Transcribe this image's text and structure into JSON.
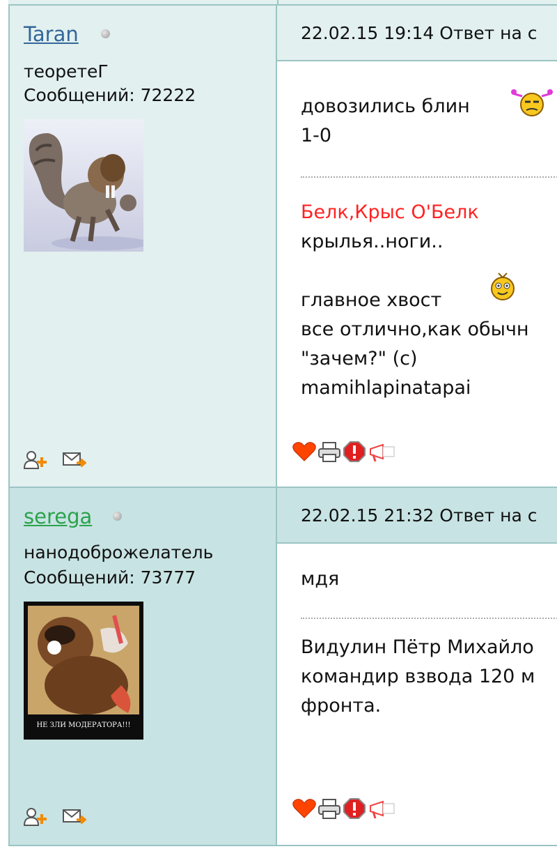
{
  "posts": [
    {
      "username": "Taran",
      "rank": "теоретеГ",
      "posts_count": "Сообщений: 72222",
      "avatar": "squirrel-avatar",
      "header": "22.02.15 19:14  Ответ на с",
      "body_lines": [
        "довозились блин",
        "1-0"
      ],
      "signature_red": "Белк,Крыс О'Белк",
      "signature_lines": [
        "крылья..ноги..",
        "",
        "главное хвост",
        "все отлично,как обычн",
        "\"зачем?\" (с)",
        "mamihlapinatapai"
      ],
      "user_colors": {
        "name": "#336699"
      }
    },
    {
      "username": "serega",
      "rank": "нанодоброжелатель",
      "posts_count": "Сообщений: 73777",
      "avatar": "bear-moderator-avatar",
      "avatar_caption": "НЕ ЗЛИ МОДЕРАТОРА!!!",
      "header": "22.02.15 21:32  Ответ на с",
      "body_lines": [
        "мдя"
      ],
      "signature_lines": [
        "Видулин Пётр Михайло",
        "командир взвода 120 м",
        "фронта."
      ],
      "user_colors": {
        "name": "#2ba24c"
      }
    }
  ],
  "icons": {
    "user_actions": [
      "add-friend-icon",
      "send-message-icon"
    ],
    "message_actions": [
      "like-heart-icon",
      "print-icon",
      "report-icon",
      "announce-icon"
    ]
  }
}
